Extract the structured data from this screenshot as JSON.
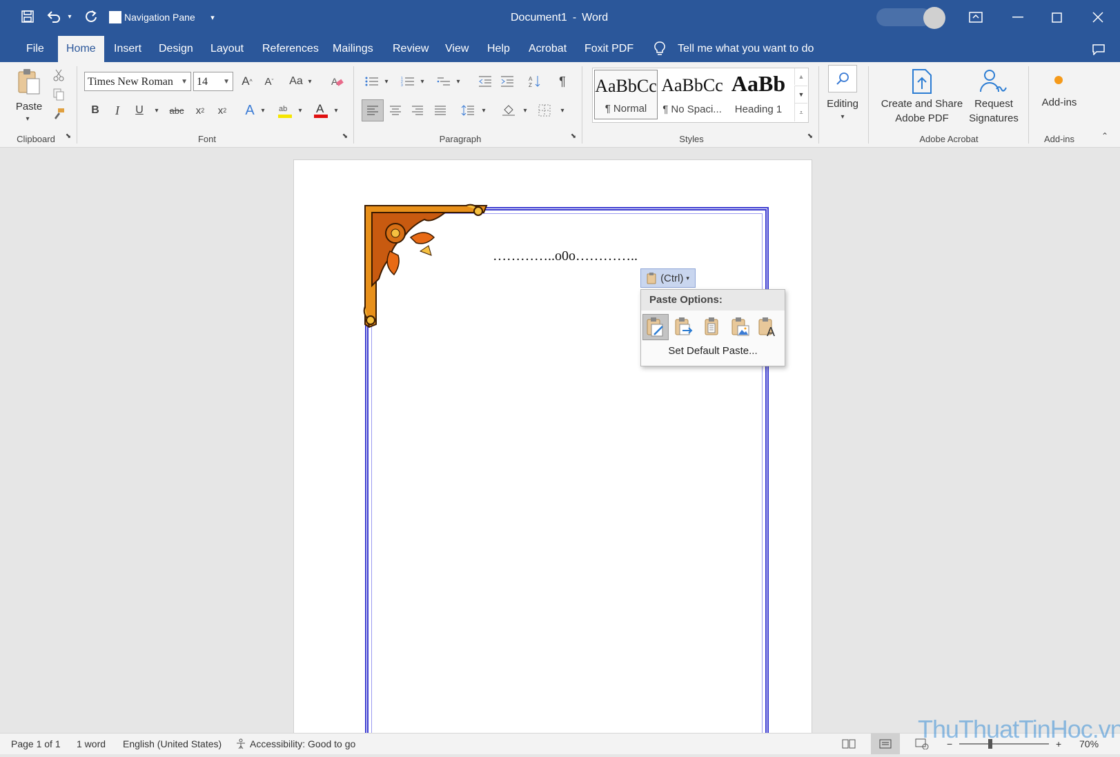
{
  "titlebar": {
    "title": "Document1",
    "app": "Word",
    "separator": "-",
    "nav_pane_label": "Navigation Pane"
  },
  "menu": {
    "tabs": [
      "File",
      "Home",
      "Insert",
      "Design",
      "Layout",
      "References",
      "Mailings",
      "Review",
      "View",
      "Help",
      "Acrobat",
      "Foxit PDF"
    ],
    "active": "Home",
    "tell_me": "Tell me what you want to do"
  },
  "ribbon": {
    "clipboard": {
      "paste_label": "Paste",
      "group_label": "Clipboard"
    },
    "font": {
      "family": "Times New Roman",
      "size": "14",
      "group_label": "Font",
      "change_case": "Aa"
    },
    "paragraph": {
      "group_label": "Paragraph"
    },
    "styles": {
      "group_label": "Styles",
      "items": [
        {
          "preview": "AaBbCc",
          "name": "¶ Normal"
        },
        {
          "preview": "AaBbCc",
          "name": "¶ No Spaci..."
        },
        {
          "preview": "AaBb",
          "name": "Heading 1"
        }
      ]
    },
    "editing": {
      "label": "Editing"
    },
    "acrobat": {
      "create_line1": "Create and Share",
      "create_line2": "Adobe PDF",
      "request_line1": "Request",
      "request_line2": "Signatures",
      "group_label": "Adobe Acrobat"
    },
    "addins": {
      "label": "Add-ins",
      "group_label": "Add-ins"
    }
  },
  "document": {
    "text": "…………..o0o…………..",
    "ctrl_label": "(Ctrl)",
    "paste_menu": {
      "header": "Paste Options:",
      "set_default": "Set Default Paste..."
    }
  },
  "status": {
    "page": "Page 1 of 1",
    "words": "1 word",
    "language": "English (United States)",
    "accessibility": "Accessibility: Good to go",
    "zoom": "70%"
  },
  "watermark": "ThuThuatTinHoc.vn",
  "colors": {
    "brand": "#2b579a",
    "page_border": "#3a3ad0",
    "ribbon_bg": "#f3f3f3"
  }
}
